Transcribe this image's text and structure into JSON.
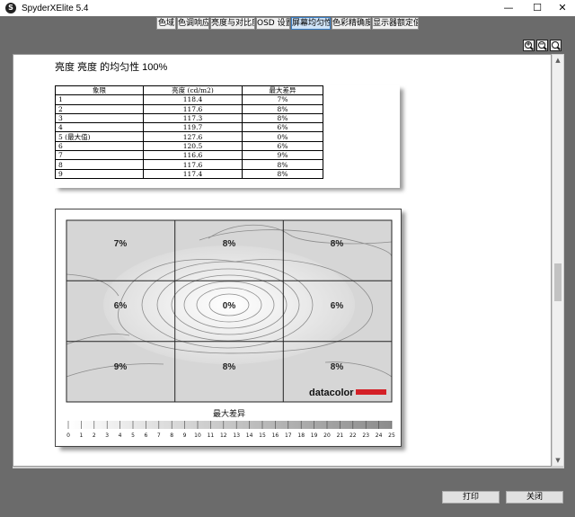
{
  "window": {
    "title": "SpyderXElite 5.4",
    "icon_letter": "S"
  },
  "tabs": [
    {
      "label": "色域",
      "active": false
    },
    {
      "label": "色调响应",
      "active": false
    },
    {
      "label": "亮度与对比度",
      "active": false
    },
    {
      "label": "OSD 设置",
      "active": false
    },
    {
      "label": "屏幕均匀性",
      "active": true
    },
    {
      "label": "色彩精确度",
      "active": false
    },
    {
      "label": "显示器额定值",
      "active": false
    }
  ],
  "report": {
    "heading": "亮度 亮度 的均匀性 100%",
    "table": {
      "headers": [
        "象限",
        "亮度 (cd/m2)",
        "最大差异"
      ],
      "rows": [
        [
          "1",
          "118.4",
          "7%"
        ],
        [
          "2",
          "117.6",
          "8%"
        ],
        [
          "3",
          "117.3",
          "8%"
        ],
        [
          "4",
          "119.7",
          "6%"
        ],
        [
          "5 (最大值)",
          "127.6",
          "0%"
        ],
        [
          "6",
          "120.5",
          "6%"
        ],
        [
          "7",
          "116.6",
          "9%"
        ],
        [
          "8",
          "117.6",
          "8%"
        ],
        [
          "9",
          "117.4",
          "8%"
        ]
      ]
    },
    "map": {
      "cells": [
        "7%",
        "8%",
        "8%",
        "6%",
        "0%",
        "6%",
        "9%",
        "8%",
        "8%"
      ],
      "brand": "datacolor",
      "legend_title": "最大差异",
      "scale_ticks": [
        "0",
        "1",
        "2",
        "3",
        "4",
        "5",
        "6",
        "7",
        "8",
        "9",
        "10",
        "11",
        "12",
        "13",
        "14",
        "15",
        "16",
        "17",
        "18",
        "19",
        "20",
        "21",
        "22",
        "23",
        "24",
        "25"
      ],
      "brand_color": "#d42027"
    }
  },
  "buttons": {
    "print": "打印",
    "close": "关闭"
  },
  "colors": {
    "active_tab": "#cfe3f7",
    "background": "#6b6b6b"
  }
}
